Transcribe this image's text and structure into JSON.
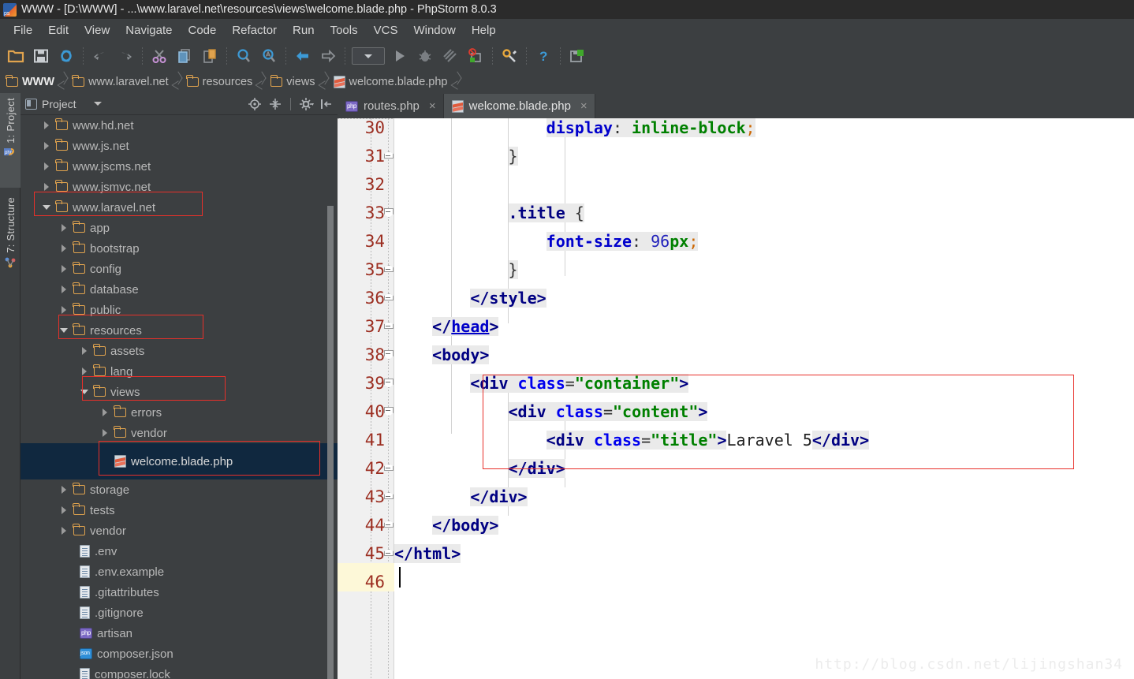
{
  "window": {
    "title": "WWW - [D:\\WWW] - ...\\www.laravel.net\\resources\\views\\welcome.blade.php - PhpStorm 8.0.3",
    "app_icon": "phpstorm-logo-icon"
  },
  "menubar": {
    "items": [
      {
        "label": "File"
      },
      {
        "label": "Edit"
      },
      {
        "label": "View"
      },
      {
        "label": "Navigate"
      },
      {
        "label": "Code"
      },
      {
        "label": "Refactor"
      },
      {
        "label": "Run"
      },
      {
        "label": "Tools"
      },
      {
        "label": "VCS"
      },
      {
        "label": "Window"
      },
      {
        "label": "Help"
      }
    ]
  },
  "toolbar": {
    "buttons": [
      {
        "icon": "open-folder-icon"
      },
      {
        "icon": "save-all-icon"
      },
      {
        "icon": "sync-refresh-icon"
      },
      {
        "sep": true
      },
      {
        "icon": "undo-arrow-icon"
      },
      {
        "icon": "redo-arrow-icon"
      },
      {
        "sep": true
      },
      {
        "icon": "cut-scissors-icon"
      },
      {
        "icon": "copy-icon"
      },
      {
        "icon": "paste-icon"
      },
      {
        "sep": true
      },
      {
        "icon": "find-magnifier-icon"
      },
      {
        "icon": "find-replace-icon"
      },
      {
        "sep": true
      },
      {
        "icon": "back-arrow-icon"
      },
      {
        "icon": "forward-arrow-icon"
      },
      {
        "sep": true
      },
      {
        "icon": "run-config-dropdown"
      },
      {
        "icon": "run-play-icon"
      },
      {
        "icon": "debug-bug-icon"
      },
      {
        "icon": "coverage-icon"
      },
      {
        "icon": "stop-deploy-icon"
      },
      {
        "sep": true
      },
      {
        "icon": "settings-wrench-icon"
      },
      {
        "sep": true
      },
      {
        "icon": "help-question-icon"
      },
      {
        "sep": true
      },
      {
        "icon": "deploy-upload-icon"
      }
    ]
  },
  "breadcrumb": {
    "items": [
      {
        "label": "WWW",
        "icon": "folder-icon"
      },
      {
        "label": "www.laravel.net",
        "icon": "folder-icon"
      },
      {
        "label": "resources",
        "icon": "folder-icon"
      },
      {
        "label": "views",
        "icon": "folder-icon"
      },
      {
        "label": "welcome.blade.php",
        "icon": "blade-file-icon"
      }
    ]
  },
  "left_strip": {
    "tools": [
      {
        "label": "1: Project",
        "icon": "project-php-icon",
        "active": true
      },
      {
        "label": "7: Structure",
        "icon": "structure-nodes-icon",
        "active": false
      }
    ]
  },
  "project_panel": {
    "title": "Project",
    "title_icon": "project-view-icon",
    "tools": [
      {
        "icon": "locate-target-icon"
      },
      {
        "icon": "collapse-all-icon"
      },
      {
        "icon": "settings-gear-icon"
      },
      {
        "icon": "hide-panel-icon"
      }
    ],
    "tree": [
      {
        "label": "www.hd.net",
        "depth": 0,
        "state": "closed",
        "icon": "folder-icon"
      },
      {
        "label": "www.js.net",
        "depth": 0,
        "state": "closed",
        "icon": "folder-locked-icon"
      },
      {
        "label": "www.jscms.net",
        "depth": 0,
        "state": "closed",
        "icon": "folder-icon"
      },
      {
        "label": "www.jsmvc.net",
        "depth": 0,
        "state": "closed",
        "icon": "folder-icon"
      },
      {
        "label": "www.laravel.net",
        "depth": 0,
        "state": "open",
        "icon": "folder-icon",
        "highlight": true
      },
      {
        "label": "app",
        "depth": 1,
        "state": "closed",
        "icon": "folder-icon"
      },
      {
        "label": "bootstrap",
        "depth": 1,
        "state": "closed",
        "icon": "folder-icon"
      },
      {
        "label": "config",
        "depth": 1,
        "state": "closed",
        "icon": "folder-icon"
      },
      {
        "label": "database",
        "depth": 1,
        "state": "closed",
        "icon": "folder-icon"
      },
      {
        "label": "public",
        "depth": 1,
        "state": "closed",
        "icon": "folder-icon"
      },
      {
        "label": "resources",
        "depth": 1,
        "state": "open",
        "icon": "folder-icon",
        "highlight": true
      },
      {
        "label": "assets",
        "depth": 2,
        "state": "closed",
        "icon": "folder-icon"
      },
      {
        "label": "lang",
        "depth": 2,
        "state": "closed",
        "icon": "folder-icon"
      },
      {
        "label": "views",
        "depth": 2,
        "state": "open",
        "icon": "folder-icon",
        "highlight": true
      },
      {
        "label": "errors",
        "depth": 3,
        "state": "closed",
        "icon": "folder-icon"
      },
      {
        "label": "vendor",
        "depth": 3,
        "state": "closed",
        "icon": "folder-icon"
      },
      {
        "label": "welcome.blade.php",
        "depth": 3,
        "state": "leaf",
        "icon": "blade-file-icon",
        "selected": true,
        "highlight": true
      },
      {
        "label": "storage",
        "depth": 1,
        "state": "closed",
        "icon": "folder-icon"
      },
      {
        "label": "tests",
        "depth": 1,
        "state": "closed",
        "icon": "folder-icon"
      },
      {
        "label": "vendor",
        "depth": 1,
        "state": "closed",
        "icon": "folder-icon"
      },
      {
        "label": ".env",
        "depth": 1,
        "state": "leaf",
        "icon": "text-file-icon"
      },
      {
        "label": ".env.example",
        "depth": 1,
        "state": "leaf",
        "icon": "text-file-icon"
      },
      {
        "label": ".gitattributes",
        "depth": 1,
        "state": "leaf",
        "icon": "text-file-icon"
      },
      {
        "label": ".gitignore",
        "depth": 1,
        "state": "leaf",
        "icon": "text-file-icon"
      },
      {
        "label": "artisan",
        "depth": 1,
        "state": "leaf",
        "icon": "php-file-icon"
      },
      {
        "label": "composer.json",
        "depth": 1,
        "state": "leaf",
        "icon": "json-file-icon"
      },
      {
        "label": "composer.lock",
        "depth": 1,
        "state": "leaf",
        "icon": "text-file-icon"
      }
    ]
  },
  "editor": {
    "tabs": [
      {
        "label": "routes.php",
        "icon": "php-file-icon",
        "active": false,
        "close": "×"
      },
      {
        "label": "welcome.blade.php",
        "icon": "blade-file-icon",
        "active": true,
        "close": "×"
      }
    ],
    "first_line": 30,
    "caret_line": 46,
    "lines": [
      {
        "no": "30",
        "fold": null
      },
      {
        "no": "31",
        "fold": "up"
      },
      {
        "no": "32",
        "fold": null
      },
      {
        "no": "33",
        "fold": "down"
      },
      {
        "no": "34",
        "fold": null
      },
      {
        "no": "35",
        "fold": "up"
      },
      {
        "no": "36",
        "fold": "up"
      },
      {
        "no": "37",
        "fold": "up"
      },
      {
        "no": "38",
        "fold": "down"
      },
      {
        "no": "39",
        "fold": "down"
      },
      {
        "no": "40",
        "fold": "down"
      },
      {
        "no": "41",
        "fold": null
      },
      {
        "no": "42",
        "fold": "up"
      },
      {
        "no": "43",
        "fold": "up"
      },
      {
        "no": "44",
        "fold": "up"
      },
      {
        "no": "45",
        "fold": "up"
      },
      {
        "no": "46",
        "fold": null
      }
    ],
    "code": {
      "l30": "            display: inline-block;",
      "l31": "        }",
      "l32": "",
      "l33": "        .title {",
      "l34": "            font-size: 96px;",
      "l35": "        }",
      "l36": "    </style>",
      "l37": "</head>",
      "l38": "<body>",
      "l39": "    <div class=\"container\">",
      "l40": "        <div class=\"content\">",
      "l41": "            <div class=\"title\">Laravel 5</div>",
      "l42": "        </div>",
      "l43": "    </div>",
      "l44": "</body>",
      "l45": "</html>",
      "l46": ""
    },
    "tokens": {
      "display_prop": "display",
      "display_val": "inline-block",
      "title_sel": ".title",
      "fontsize_prop": "font-size",
      "fontsize_num": "96",
      "fontsize_unit": "px",
      "style_close": "</style>",
      "head_close": "</head>",
      "body_open": "<body>",
      "div_container_class": "\"container\"",
      "div_content_class": "\"content\"",
      "div_title_class": "\"title\"",
      "title_text": "Laravel 5",
      "div_close": "</div>",
      "body_close": "</body>",
      "html_close": "</html>",
      "class_kw": "class",
      "div_kw": "div"
    }
  },
  "watermark": {
    "text": "http://blog.csdn.net/lijingshan34"
  },
  "colors": {
    "window_bg": "#3c3f41",
    "titlebar_bg": "#2b2b2b",
    "editor_bg": "#ffffff",
    "gutter_bg": "#f0f0f0",
    "linenum": "#9c2e21",
    "selection_row": "#10283f",
    "annotation_red": "#e8302a",
    "caret_line": "#fdf8d8",
    "folder_orange": "#e0a34e",
    "tab_active_bg": "#4e5254"
  }
}
